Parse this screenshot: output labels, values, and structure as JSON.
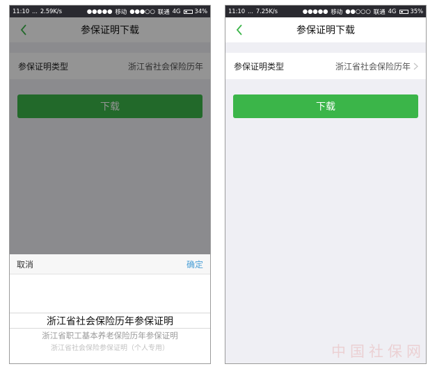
{
  "left_phone": {
    "status": {
      "time": "11:10",
      "dots": "...",
      "speed": "2.59K/s",
      "carrier1_signal": "●●●●●",
      "carrier1": "移动",
      "carrier2_signal": "●●●○○",
      "carrier2": "联通",
      "network": "4G",
      "battery": "34%",
      "battery_level": 0.34
    },
    "nav": {
      "title": "参保证明下载"
    },
    "row": {
      "label": "参保证明类型",
      "value": "浙江省社会保险历年"
    },
    "download_label": "下载",
    "picker": {
      "cancel": "取消",
      "confirm": "确定",
      "options": [
        "浙江省社会保险历年参保证明",
        "浙江省职工基本养老保险历年参保证明",
        "浙江省社会保险参保证明（个人专用）"
      ]
    }
  },
  "right_phone": {
    "status": {
      "time": "11:10",
      "dots": "...",
      "speed": "7.25K/s",
      "carrier1_signal": "●●●●●",
      "carrier1": "移动",
      "carrier2_signal": "●●○○○",
      "carrier2": "联通",
      "network": "4G",
      "battery": "35%",
      "battery_level": 0.35
    },
    "nav": {
      "title": "参保证明下载"
    },
    "row": {
      "label": "参保证明类型",
      "value": "浙江省社会保险历年"
    },
    "download_label": "下载"
  },
  "watermark": "中国社保网",
  "colors": {
    "accent_green": "#3bb549",
    "link_blue": "#4a9fd6",
    "statusbar_bg": "#2a2a30",
    "page_bg": "#efeff4"
  },
  "icons": {
    "back": "chevron-left-icon",
    "row_arrow": "chevron-right-icon",
    "battery": "battery-icon"
  }
}
